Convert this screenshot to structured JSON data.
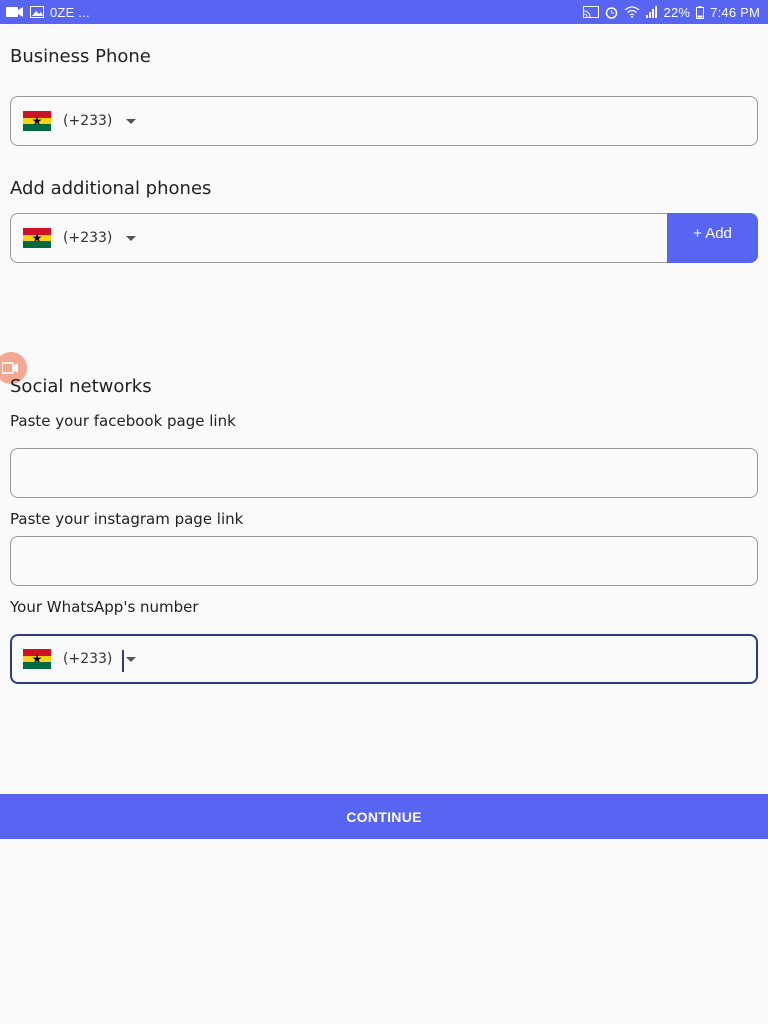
{
  "status_bar": {
    "left_icons": [
      "video-icon",
      "image-icon",
      "notification-icon"
    ],
    "left_text": "0ZE ...",
    "right_icons": [
      "cast-icon",
      "alarm-icon",
      "wifi-icon",
      "signal-icon",
      "battery-icon"
    ],
    "battery": "22%",
    "time": "7:46 PM",
    "background": "#5865f2"
  },
  "business_phone": {
    "title": "Business Phone",
    "country_code": "(+233)"
  },
  "additional_phones": {
    "title": "Add additional phones",
    "country_code": "(+233)",
    "add_label": "+ Add"
  },
  "social": {
    "title": "Social networks",
    "facebook_label": "Paste your facebook page link",
    "facebook_value": "",
    "instagram_label": "Paste your instagram page link",
    "instagram_value": "",
    "whatsapp_label": "Your WhatsApp's number",
    "whatsapp_code": "(+233)"
  },
  "continue_label": "CONTINUE",
  "colors": {
    "accent": "#5865f2",
    "focus_border": "#2f3a8f"
  }
}
